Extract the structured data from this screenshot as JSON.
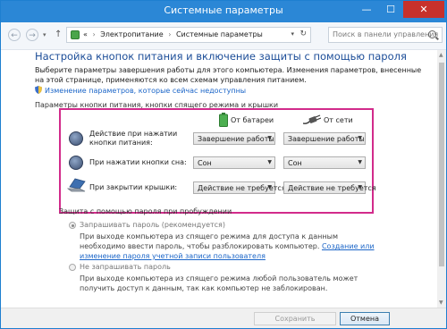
{
  "window": {
    "title": "Системные параметры",
    "minimize": "—",
    "maximize": "☐",
    "close": "✕"
  },
  "nav": {
    "back": "←",
    "forward": "→",
    "dropdown": "▾",
    "up": "↑",
    "breadcrumb_prefix": "«",
    "crumbs": [
      "Электропитание",
      "Системные параметры"
    ],
    "crumb_separator": "›",
    "address_dropdown": "▾",
    "refresh": "↻",
    "search_placeholder": "Поиск в панели управления"
  },
  "main": {
    "heading": "Настройка кнопок питания и включение защиты с помощью пароля",
    "intro": "Выберите параметры завершения работы для этого компьютера. Изменения параметров, внесенные на этой странице, применяются ко всем схемам управления питанием.",
    "admin_link": "Изменение параметров, которые сейчас недоступны",
    "buttons_section": "Параметры кнопки питания, кнопки спящего режима и крышки",
    "columns": {
      "battery": "От батареи",
      "plugged": "От сети"
    },
    "rows": [
      {
        "label": "Действие при нажатии кнопки питания:",
        "battery": "Завершение работы",
        "plugged": "Завершение работы"
      },
      {
        "label": "При нажатии кнопки сна:",
        "battery": "Сон",
        "plugged": "Сон"
      },
      {
        "label": "При закрытии крышки:",
        "battery": "Действие не требуется",
        "plugged": "Действие не требуется"
      }
    ],
    "password_section": "Защита с помощью пароля при пробуждении",
    "require_password": {
      "label": "Запрашивать пароль (рекомендуется)",
      "desc": "При выходе компьютера из спящего режима для доступа к данным необходимо ввести пароль, чтобы разблокировать компьютер.",
      "link": "Создание или изменение пароля учетной записи пользователя",
      "selected": true
    },
    "no_password": {
      "label": "Не запрашивать пароль",
      "desc": "При выходе компьютера из спящего режима любой пользователь может получить доступ к данным, так как компьютер не заблокирован.",
      "selected": false
    }
  },
  "footer": {
    "save": "Сохранить изменения",
    "cancel": "Отмена"
  },
  "colors": {
    "accent": "#2b87d6",
    "highlight_box": "#d22b8b",
    "link": "#1c66c8"
  }
}
